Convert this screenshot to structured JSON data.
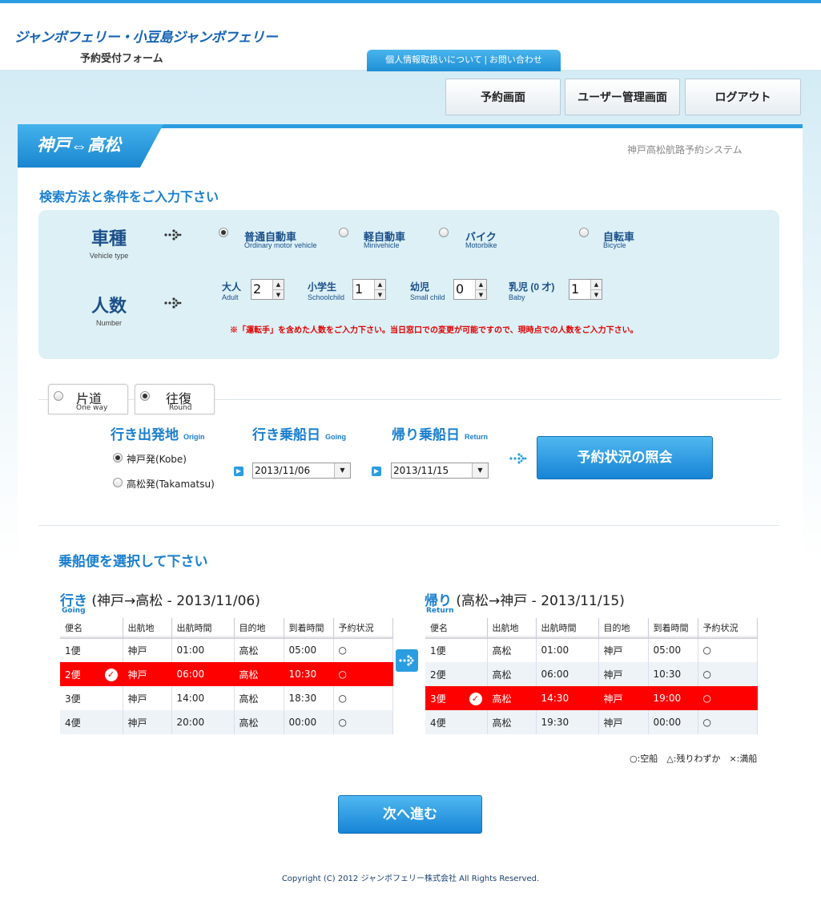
{
  "header": {
    "logo": "ジャンボフェリー・小豆島ジャンボフェリー",
    "subtitle": "予約受付フォーム",
    "privacy_link": "個人情報取扱いについて",
    "contact_link": "お問い合わせ",
    "separator": "|"
  },
  "nav": {
    "reserve": "予約画面",
    "user_admin": "ユーザー管理画面",
    "logout": "ログアウト"
  },
  "route": {
    "title": "神戸⇔高松",
    "system_name": "神戸高松航路予約システム"
  },
  "search": {
    "title": "検索方法と条件をご入力下さい",
    "vehicle": {
      "label_jp": "車種",
      "label_en": "Vehicle type",
      "options": [
        {
          "jp": "普通自動車",
          "en": "Ordinary motor vehicle",
          "selected": true
        },
        {
          "jp": "軽自動車",
          "en": "Minivehicle",
          "selected": false
        },
        {
          "jp": "バイク",
          "en": "Motorbike",
          "selected": false
        },
        {
          "jp": "自転車",
          "en": "Bicycle",
          "selected": false
        }
      ]
    },
    "passengers": {
      "label_jp": "人数",
      "label_en": "Number",
      "adult": {
        "jp": "大人",
        "en": "Adult",
        "value": "2"
      },
      "child": {
        "jp": "小学生",
        "en": "Schoolchild",
        "value": "1"
      },
      "infant": {
        "jp": "幼児",
        "en": "Small child",
        "value": "0"
      },
      "baby": {
        "jp": "乳児 (0 才)",
        "en": "Baby",
        "value": "1"
      }
    },
    "notice": "※「運転手」を含めた人数をご入力下さい。当日窓口での変更が可能ですので、現時点での人数をご入力下さい。"
  },
  "trip": {
    "oneway": {
      "jp": "片道",
      "en": "One way",
      "selected": false
    },
    "round": {
      "jp": "往復",
      "en": "Round",
      "selected": true
    },
    "origin_title": "行き出発地",
    "origin_title_en": "Origin",
    "origin_kobe": "神戸発(Kobe)",
    "origin_takamatsu": "高松発(Takamatsu)",
    "going_title": "行き乗船日",
    "going_title_en": "Going",
    "going_date": "2013/11/06",
    "return_title": "帰り乗船日",
    "return_title_en": "Return",
    "return_date": "2013/11/15",
    "inquiry_button": "予約状況の照会"
  },
  "schedule": {
    "title": "乗船便を選択して下さい",
    "headers": [
      "便名",
      "出航地",
      "出航時間",
      "目的地",
      "到着時間",
      "予約状況"
    ],
    "going": {
      "label": "行き",
      "label_en": "Going",
      "route": "(神戸→高松 - 2013/11/06)",
      "rows": [
        [
          "1便",
          "神戸",
          "01:00",
          "高松",
          "05:00",
          "○"
        ],
        [
          "2便",
          "神戸",
          "06:00",
          "高松",
          "10:30",
          "○"
        ],
        [
          "3便",
          "神戸",
          "14:00",
          "高松",
          "18:30",
          "○"
        ],
        [
          "4便",
          "神戸",
          "20:00",
          "高松",
          "00:00",
          "○"
        ]
      ]
    },
    "return": {
      "label": "帰り",
      "label_en": "Return",
      "route": "(高松→神戸 - 2013/11/15)",
      "rows": [
        [
          "1便",
          "高松",
          "01:00",
          "神戸",
          "05:00",
          "○"
        ],
        [
          "2便",
          "高松",
          "06:00",
          "神戸",
          "10:30",
          "○"
        ],
        [
          "3便",
          "高松",
          "14:30",
          "神戸",
          "19:00",
          "○"
        ],
        [
          "4便",
          "高松",
          "19:30",
          "神戸",
          "00:00",
          "○"
        ]
      ]
    },
    "legend": "○:空船　△:残りわずか　×:満船",
    "next_button": "次へ進む"
  },
  "footer": {
    "copyright": "Copyright (C) 2012 ジャンボフェリー株式会社 All Rights Reserved."
  },
  "colors": {
    "accent": "#2a9de0",
    "selected_row": "#ff0000",
    "notice": "#e00000"
  }
}
